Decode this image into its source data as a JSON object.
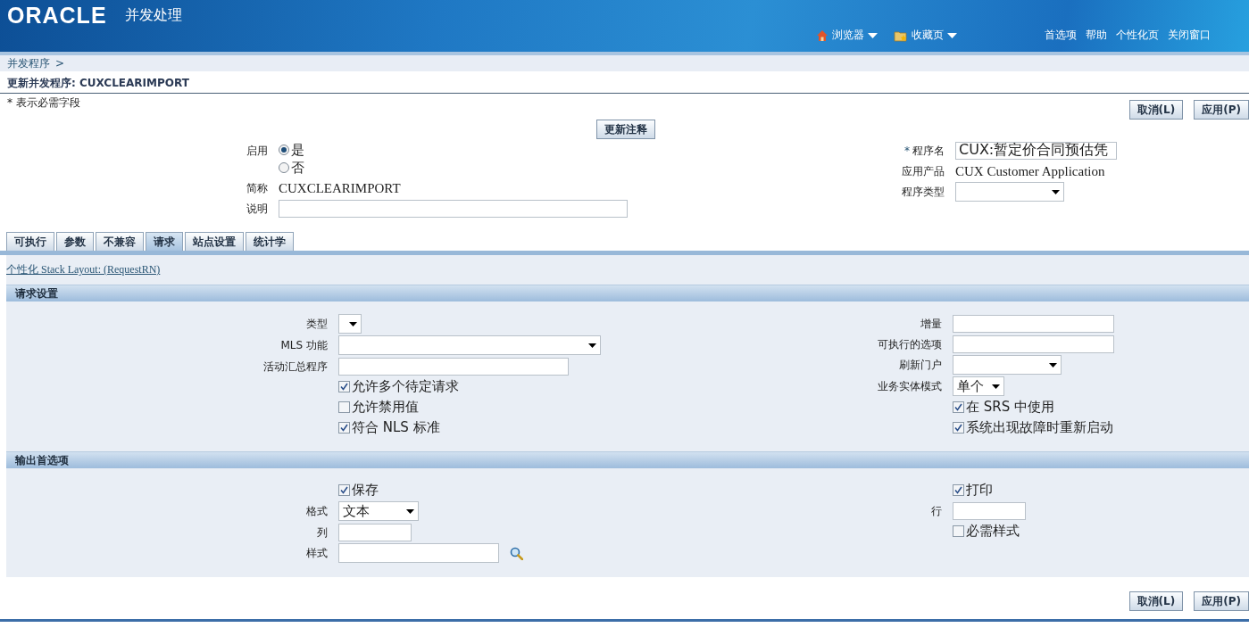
{
  "header": {
    "logo": "ORACLE",
    "title": "并发处理",
    "nav": [
      {
        "label": "浏览器"
      },
      {
        "label": "收藏页"
      }
    ],
    "links": [
      "首选项",
      "帮助",
      "个性化页",
      "关闭窗口"
    ]
  },
  "breadcrumb": [
    {
      "label": "并发程序",
      "separator": ">"
    }
  ],
  "page_title": "更新并发程序: CUXCLEARIMPORT",
  "required_note": "* 表示必需字段",
  "top_buttons": [
    "取消(L)",
    "应用(P)"
  ],
  "update_button": "更新注释",
  "main_form": {
    "left": [
      {
        "kind": "radio",
        "label": "启用",
        "options": [
          {
            "label": "是",
            "selected": true
          },
          {
            "label": "否",
            "selected": false
          }
        ]
      },
      {
        "kind": "text",
        "label": "简称",
        "value": "CUXCLEARIMPORT"
      },
      {
        "kind": "input",
        "label": "说明"
      }
    ],
    "right": [
      {
        "kind": "input",
        "label": "程序名",
        "required_mark": "*",
        "value": "CUX:暂定价合同预估凭"
      },
      {
        "kind": "text",
        "label": "应用产品",
        "value": "CUX Customer Application"
      },
      {
        "kind": "select",
        "label": "程序类型"
      }
    ]
  },
  "tabs": [
    {
      "label": "可执行",
      "selected": false
    },
    {
      "label": "参数",
      "selected": false
    },
    {
      "label": "不兼容",
      "selected": false
    },
    {
      "label": "请求",
      "selected": true
    },
    {
      "label": "站点设置",
      "selected": false
    },
    {
      "label": "统计学",
      "selected": false
    }
  ],
  "personalize_link": "个性化  Stack Layout: (RequestRN)",
  "sections": [
    {
      "title": "请求设置",
      "left": [
        {
          "kind": "select",
          "label": "类型"
        },
        {
          "kind": "select",
          "label": "MLS 功能"
        },
        {
          "kind": "input",
          "label": "活动汇总程序"
        },
        {
          "kind": "checkbox",
          "label": "允许多个待定请求",
          "checked": true
        },
        {
          "kind": "checkbox",
          "label": "允许禁用值",
          "checked": false
        },
        {
          "kind": "checkbox",
          "label": "符合  NLS 标准",
          "checked": true
        }
      ],
      "right": [
        {
          "kind": "input",
          "label": "增量"
        },
        {
          "kind": "input",
          "label": "可执行的选项"
        },
        {
          "kind": "select",
          "label": "刷新门户"
        },
        {
          "kind": "select",
          "label": "业务实体模式",
          "value": "单个"
        },
        {
          "kind": "checkbox",
          "label": "在  SRS 中使用",
          "checked": true
        },
        {
          "kind": "checkbox",
          "label": "系统出现故障时重新启动",
          "checked": true
        }
      ]
    },
    {
      "title": "输出首选项",
      "left": [
        {
          "kind": "checkbox",
          "label": "保存",
          "checked": true
        },
        {
          "kind": "select",
          "label": "格式",
          "value": "文本"
        },
        {
          "kind": "input",
          "label": "列"
        },
        {
          "kind": "lookup",
          "label": "样式"
        }
      ],
      "right": [
        {
          "kind": "checkbox",
          "label": "打印",
          "checked": true
        },
        {
          "kind": "input",
          "label": "行"
        },
        {
          "kind": "checkbox",
          "label": "必需样式",
          "checked": false
        }
      ]
    }
  ],
  "bottom_buttons": [
    "取消(L)",
    "应用(P)"
  ]
}
